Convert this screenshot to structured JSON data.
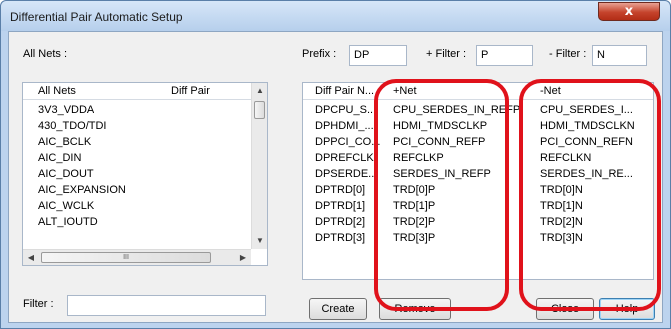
{
  "window": {
    "title": "Differential Pair Automatic Setup",
    "close_glyph": "x"
  },
  "all_nets": {
    "label": "All Nets :",
    "columns": [
      "All Nets",
      "Diff Pair"
    ],
    "items": [
      "3V3_VDDA",
      "430_TDO/TDI",
      "AIC_BCLK",
      "AIC_DIN",
      "AIC_DOUT",
      "AIC_EXPANSION",
      "AIC_WCLK",
      "ALT_IOUTD"
    ],
    "scroll_up": "▲",
    "scroll_down": "▼",
    "scroll_left": "◀",
    "scroll_right": "▶",
    "h_thumb_grip": "III"
  },
  "filter": {
    "label": "Filter :",
    "value": ""
  },
  "prefix": {
    "label": "Prefix :",
    "value": "DP"
  },
  "plus_filter": {
    "label": "+ Filter :",
    "value": "P"
  },
  "minus_filter": {
    "label": "- Filter :",
    "value": "N"
  },
  "pairs": {
    "columns": [
      "Diff Pair N...",
      "+Net",
      "-Net"
    ],
    "rows": [
      {
        "name": "DPCPU_S...",
        "plus": "CPU_SERDES_IN_REFP",
        "minus": "CPU_SERDES_I..."
      },
      {
        "name": "DPHDMI_...",
        "plus": "HDMI_TMDSCLKP",
        "minus": "HDMI_TMDSCLKN"
      },
      {
        "name": "DPPCI_CO...",
        "plus": "PCI_CONN_REFP",
        "minus": "PCI_CONN_REFN"
      },
      {
        "name": "DPREFCLK",
        "plus": "REFCLKP",
        "minus": "REFCLKN"
      },
      {
        "name": "DPSERDE...",
        "plus": "SERDES_IN_REFP",
        "minus": "SERDES_IN_RE..."
      },
      {
        "name": "DPTRD[0]",
        "plus": "TRD[0]P",
        "minus": "TRD[0]N"
      },
      {
        "name": "DPTRD[1]",
        "plus": "TRD[1]P",
        "minus": "TRD[1]N"
      },
      {
        "name": "DPTRD[2]",
        "plus": "TRD[2]P",
        "minus": "TRD[2]N"
      },
      {
        "name": "DPTRD[3]",
        "plus": "TRD[3]P",
        "minus": "TRD[3]N"
      }
    ]
  },
  "buttons": {
    "create": "Create",
    "remove": "Remove",
    "close": "Close",
    "help": "Help"
  },
  "colors": {
    "annotation": "#e0121b",
    "title_bar": "#c8dcf3",
    "close_button": "#c5432c"
  }
}
